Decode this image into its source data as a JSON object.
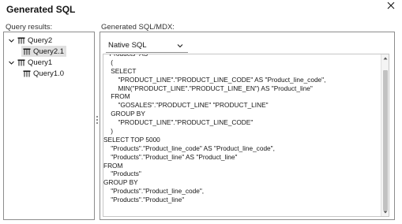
{
  "dialog": {
    "title": "Generated SQL",
    "close_icon": "close-icon"
  },
  "query_results": {
    "label": "Query results:",
    "tree": [
      {
        "label": "Query2",
        "expanded": true,
        "children": [
          {
            "label": "Query2.1",
            "selected": true
          }
        ]
      },
      {
        "label": "Query1",
        "expanded": true,
        "children": [
          {
            "label": "Query1.0",
            "selected": false
          }
        ]
      }
    ]
  },
  "generated": {
    "label": "Generated SQL/MDX:",
    "dropdown_value": "Native SQL",
    "code_lines": [
      "  \"Products\" AS",
      "    (",
      "    SELECT",
      "        \"PRODUCT_LINE\".\"PRODUCT_LINE_CODE\" AS \"Product_line_code\",",
      "        MIN(\"PRODUCT_LINE\".\"PRODUCT_LINE_EN\") AS \"Product_line\"",
      "    FROM",
      "        \"GOSALES\".\"PRODUCT_LINE\" \"PRODUCT_LINE\"",
      "    GROUP BY",
      "        \"PRODUCT_LINE\".\"PRODUCT_LINE_CODE\"",
      "    )",
      "SELECT TOP 5000",
      "    \"Products\".\"Product_line_code\" AS \"Product_line_code\",",
      "    \"Products\".\"Product_line\" AS \"Product_line\"",
      "FROM",
      "    \"Products\"",
      "GROUP BY",
      "    \"Products\".\"Product_line_code\",",
      "    \"Products\".\"Product_line\""
    ]
  },
  "colors": {
    "border": "#8d8d8d",
    "selected_bg": "#e0e0e0",
    "text": "#161616"
  }
}
